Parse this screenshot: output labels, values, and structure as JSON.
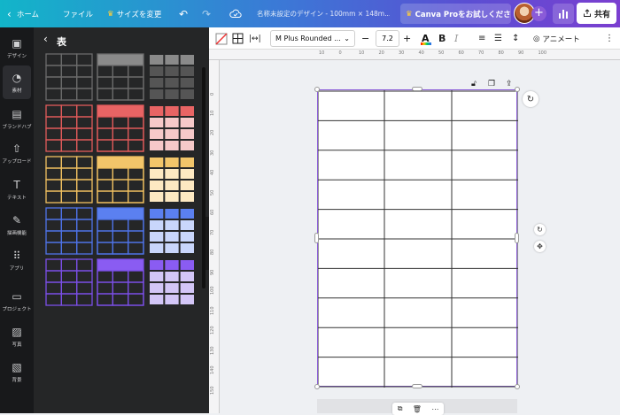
{
  "topbar": {
    "home_label": "ホーム",
    "file_label": "ファイル",
    "resize_label": "サイズを変更",
    "doc_title": "名称未設定のデザイン - 100mm × 148m...",
    "pro_label": "Canva Proをお試しくださ...",
    "share_label": "共有"
  },
  "rail": {
    "items": [
      {
        "label": "デザイン",
        "icon": "layout-icon"
      },
      {
        "label": "素材",
        "icon": "shapes-icon"
      },
      {
        "label": "ブランドハブ",
        "icon": "brand-icon"
      },
      {
        "label": "アップロード",
        "icon": "upload-icon"
      },
      {
        "label": "テキスト",
        "icon": "text-icon"
      },
      {
        "label": "描画機能",
        "icon": "draw-icon"
      },
      {
        "label": "アプリ",
        "icon": "apps-icon"
      },
      {
        "label": "プロジェクト",
        "icon": "folder-icon"
      },
      {
        "label": "写真",
        "icon": "photo-icon"
      },
      {
        "label": "背景",
        "icon": "background-icon"
      }
    ]
  },
  "panel": {
    "title": "表",
    "rows": [
      {
        "color": "#6b6b6b",
        "header": "#8a8a8a",
        "light": "#555555"
      },
      {
        "color": "#e05a5a",
        "header": "#e86464",
        "light": "#f6c9c9"
      },
      {
        "color": "#f0c060",
        "header": "#f2c56a",
        "light": "#fde9c2"
      },
      {
        "color": "#4f73e8",
        "header": "#5b80f0",
        "light": "#c9d6fb"
      },
      {
        "color": "#7b4fe6",
        "header": "#8a5cf2",
        "light": "#d3c6f7"
      }
    ]
  },
  "toolbar": {
    "font_name": "M Plus Rounded ...",
    "font_size": "7.2",
    "animate_label": "アニメート"
  },
  "ruler": {
    "top_ticks": [
      "10",
      "0",
      "10",
      "20",
      "30",
      "40",
      "50",
      "60",
      "70",
      "80",
      "90",
      "100"
    ],
    "left_ticks": [
      "0",
      "10",
      "20",
      "30",
      "40",
      "50",
      "60",
      "70",
      "80",
      "90",
      "100",
      "110",
      "120",
      "130",
      "140",
      "150"
    ]
  },
  "table": {
    "columns": 3,
    "rows": 10
  },
  "colors": {
    "accent": "#8a5bd8"
  }
}
